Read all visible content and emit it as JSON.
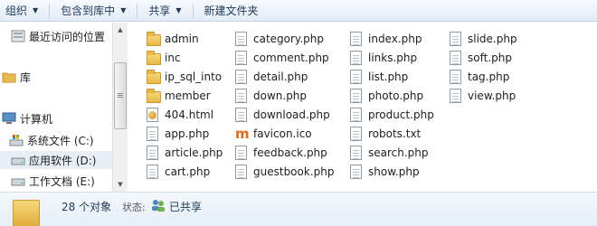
{
  "toolbar": {
    "organize": "组织",
    "include_in_library": "包含到库中",
    "share": "共享",
    "new_folder": "新建文件夹"
  },
  "nav": {
    "recent": "最近访问的位置",
    "library": "库",
    "computer": "计算机",
    "drive_c": "系统文件 (C:)",
    "drive_d": "应用软件 (D:)",
    "drive_e": "工作文档 (E:)"
  },
  "files": {
    "col1": [
      {
        "name": "admin",
        "type": "folder"
      },
      {
        "name": "inc",
        "type": "folder"
      },
      {
        "name": "ip_sql_into",
        "type": "folder"
      },
      {
        "name": "member",
        "type": "folder"
      },
      {
        "name": "404.html",
        "type": "web"
      },
      {
        "name": "app.php",
        "type": "doc"
      },
      {
        "name": "article.php",
        "type": "doc"
      },
      {
        "name": "cart.php",
        "type": "doc"
      }
    ],
    "col2": [
      {
        "name": "category.php",
        "type": "doc"
      },
      {
        "name": "comment.php",
        "type": "doc"
      },
      {
        "name": "detail.php",
        "type": "doc"
      },
      {
        "name": "down.php",
        "type": "doc"
      },
      {
        "name": "download.php",
        "type": "doc"
      },
      {
        "name": "favicon.ico",
        "type": "fav"
      },
      {
        "name": "feedback.php",
        "type": "doc"
      },
      {
        "name": "guestbook.php",
        "type": "doc"
      }
    ],
    "col3": [
      {
        "name": "index.php",
        "type": "doc"
      },
      {
        "name": "links.php",
        "type": "doc"
      },
      {
        "name": "list.php",
        "type": "doc"
      },
      {
        "name": "photo.php",
        "type": "doc"
      },
      {
        "name": "product.php",
        "type": "doc"
      },
      {
        "name": "robots.txt",
        "type": "doc"
      },
      {
        "name": "search.php",
        "type": "doc"
      },
      {
        "name": "show.php",
        "type": "doc"
      }
    ],
    "col4": [
      {
        "name": "slide.php",
        "type": "doc"
      },
      {
        "name": "soft.php",
        "type": "doc"
      },
      {
        "name": "tag.php",
        "type": "doc"
      },
      {
        "name": "view.php",
        "type": "doc"
      }
    ]
  },
  "status": {
    "count": "28 个对象",
    "state_label": "状态:",
    "state_value": "已共享"
  }
}
